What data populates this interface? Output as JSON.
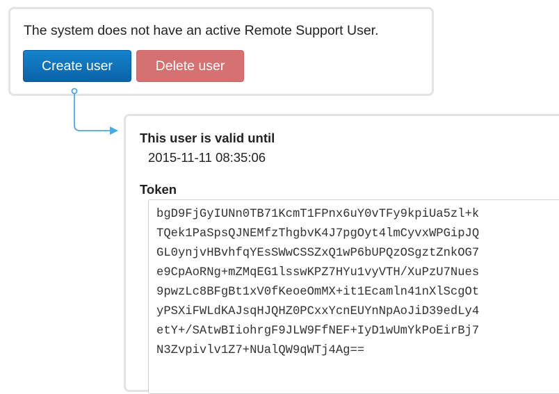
{
  "status": {
    "message": "The system does not have an active Remote Support User."
  },
  "buttons": {
    "create_label": "Create user",
    "delete_label": "Delete user"
  },
  "details": {
    "valid_until_label": "This user is valid until",
    "valid_until_value": "2015-11-11 08:35:06",
    "token_label": "Token",
    "token_lines": [
      "bgD9FjGyIUNn0TB71KcmT1FPnx6uY0vTFy9kpiUa5zl+k",
      "TQek1PaSpsQJNEMfzThgbvK4J7pgOyt4lmCyvxWPGipJQ",
      "GL0ynjvHBvhfqYEsSWwCSSZxQ1wP6bUPQzOSgztZnkOG7",
      "e9CpAoRNg+mZMqEG1lsswKPZ7HYu1vyVTH/XuPzU7Nues",
      "9pwzLc8BFgBt1xV0fKeoeOmMX+it1Ecamln41nXlScgOt",
      "yPSXiFWLdKAJsqHJQHZ0PCxxYcnEUYnNpAoJiD39edLy4",
      "etY+/SAtwBIiohrgF9JLW9FfNEF+IyD1wUmYkPoEirBj7",
      "N3Zvpivlv1Z7+NUalQW9qWTj4Ag=="
    ]
  },
  "colors": {
    "create_button": "#0b6fbb",
    "delete_button": "#d57170",
    "connector": "#4aa9e0"
  }
}
